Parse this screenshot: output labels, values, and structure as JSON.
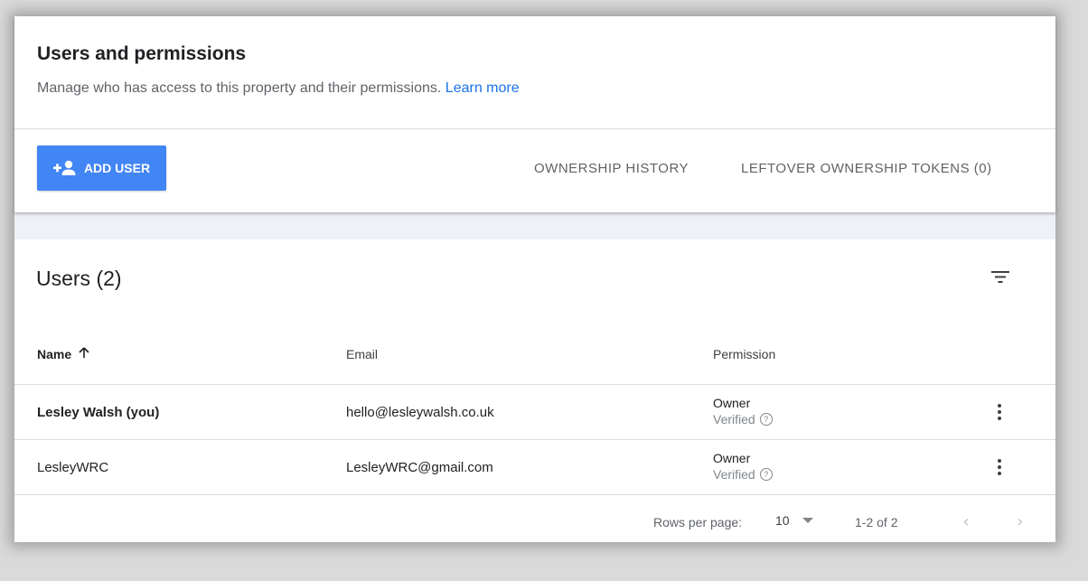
{
  "header": {
    "title": "Users and permissions",
    "subtitle": "Manage who has access to this property and their permissions.",
    "learn_more": "Learn more"
  },
  "toolbar": {
    "add_user_label": "ADD USER",
    "ownership_history_label": "OWNERSHIP HISTORY",
    "leftover_tokens_label": "LEFTOVER OWNERSHIP TOKENS (0)"
  },
  "users": {
    "title": "Users (2)",
    "columns": {
      "name": "Name",
      "email": "Email",
      "permission": "Permission"
    },
    "sort": {
      "column": "name",
      "direction": "ascending",
      "icon": "arrow-up-icon"
    },
    "rows": [
      {
        "name": "Lesley Walsh (you)",
        "email": "hello@lesleywalsh.co.uk",
        "role": "Owner",
        "status": "Verified"
      },
      {
        "name": "LesleyWRC",
        "email": "LesleyWRC@gmail.com",
        "role": "Owner",
        "status": "Verified"
      }
    ]
  },
  "pagination": {
    "rows_per_page_label": "Rows per page:",
    "rows_per_page_value": "10",
    "range": "1-2 of 2"
  },
  "colors": {
    "accent": "#4285f4",
    "link": "#1a73e8",
    "band": "#eef1f7"
  },
  "icons": [
    "add-person-icon",
    "filter-icon",
    "more-vert-icon",
    "help-icon",
    "dropdown-caret-icon",
    "chevron-left-icon",
    "chevron-right-icon"
  ]
}
